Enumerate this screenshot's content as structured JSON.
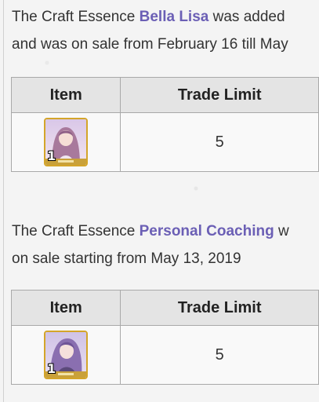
{
  "section1": {
    "text_before": "The Craft Essence ",
    "link": "Bella Lisa",
    "text_after": " was added",
    "line2": "and was on sale from February 16 till May",
    "table": {
      "header_item": "Item",
      "header_limit": "Trade Limit",
      "rows": [
        {
          "item_count": "1",
          "limit": "5",
          "icon": "bella-lisa-card-icon"
        }
      ]
    }
  },
  "section2": {
    "text_before": "The Craft Essence ",
    "link": "Personal Coaching",
    "text_after": " w",
    "line2": "on sale starting from May 13, 2019",
    "table": {
      "header_item": "Item",
      "header_limit": "Trade Limit",
      "rows": [
        {
          "item_count": "1",
          "limit": "5",
          "icon": "personal-coaching-card-icon"
        }
      ]
    }
  },
  "colors": {
    "link": "#6b5fb5",
    "card_border": "#d4a52a",
    "header_bg": "#e4e4e4",
    "table_border": "#a9a9a9"
  }
}
